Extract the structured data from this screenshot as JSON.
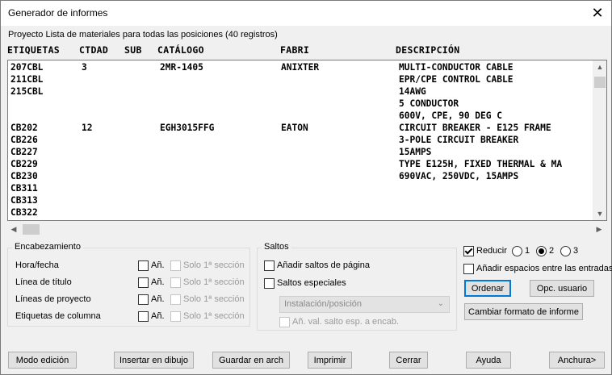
{
  "window": {
    "title": "Generador de informes",
    "close_glyph": "✕"
  },
  "project_line": "Proyecto Lista de materiales para todas las posiciones (40 registros)",
  "columns": [
    "ETIQUETAS",
    "CTDAD",
    "SUB",
    "CATÁLOGO",
    "FABRI",
    "DESCRIPCIÓN"
  ],
  "rows": [
    [
      "207CBL",
      "3",
      "",
      "2MR-1405",
      "ANIXTER",
      "MULTI-CONDUCTOR CABLE"
    ],
    [
      "211CBL",
      "",
      "",
      "",
      "",
      "EPR/CPE CONTROL CABLE"
    ],
    [
      "215CBL",
      "",
      "",
      "",
      "",
      "14AWG"
    ],
    [
      "",
      "",
      "",
      "",
      "",
      "5 CONDUCTOR"
    ],
    [
      "",
      "",
      "",
      "",
      "",
      "600V,  CPE, 90 DEG C"
    ],
    [
      "CB202",
      "12",
      "",
      "EGH3015FFG",
      "EATON",
      "CIRCUIT BREAKER - E125 FRAME"
    ],
    [
      "CB226",
      "",
      "",
      "",
      "",
      "3-POLE CIRCUIT BREAKER"
    ],
    [
      "CB227",
      "",
      "",
      "",
      "",
      "15AMPS"
    ],
    [
      "CB229",
      "",
      "",
      "",
      "",
      "TYPE E125H, FIXED THERMAL & MA"
    ],
    [
      "CB230",
      "",
      "",
      "",
      "",
      "690VAC, 250VDC, 15AMPS"
    ],
    [
      "CB311",
      "",
      "",
      "",
      "",
      ""
    ],
    [
      "CB313",
      "",
      "",
      "",
      "",
      ""
    ],
    [
      "CB322",
      "",
      "",
      "",
      "",
      ""
    ]
  ],
  "scroll_icons": {
    "up": "▲",
    "down": "▼",
    "left": "◀",
    "right": "▶"
  },
  "encabezamiento": {
    "legend": "Encabezamiento",
    "items": [
      {
        "label": "Hora/fecha",
        "an": "Añ.",
        "solo": "Solo 1ª sección"
      },
      {
        "label": "Línea de título",
        "an": "Añ.",
        "solo": "Solo 1ª sección"
      },
      {
        "label": "Líneas de proyecto",
        "an": "Añ.",
        "solo": "Solo 1ª sección"
      },
      {
        "label": "Etiquetas de columna",
        "an": "Añ.",
        "solo": "Solo 1ª sección"
      }
    ]
  },
  "saltos": {
    "legend": "Saltos",
    "add_page_breaks": "Añadir saltos de página",
    "special_breaks": "Saltos especiales",
    "dropdown_value": "Instalación/posición",
    "dropdown_icon": "chevron-down",
    "an_val": "Añ. val. salto esp. a encab."
  },
  "right_options": {
    "reducir": "Reducir",
    "reducir_checked": true,
    "radio_options": [
      "1",
      "2",
      "3"
    ],
    "radio_selected": "2",
    "add_spaces": "Añadir espacios entre las entradas",
    "ordenar": "Ordenar",
    "opc_usuario": "Opc. usuario",
    "cambiar_formato": "Cambiar formato de informe"
  },
  "bottom_buttons": {
    "modo_edicion": "Modo edición",
    "insertar": "Insertar en dibujo",
    "guardar": "Guardar en arch",
    "imprimir": "Imprimir",
    "cerrar": "Cerrar",
    "ayuda": "Ayuda",
    "anchura": "Anchura>"
  }
}
